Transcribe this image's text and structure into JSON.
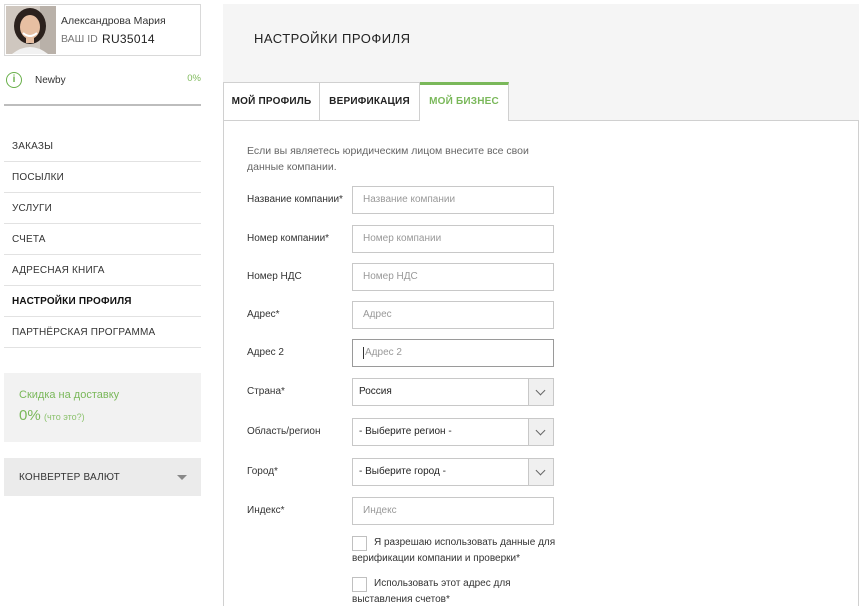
{
  "user": {
    "name": "Александрова Мария",
    "id_label": "ВАШ ID",
    "id_value": "RU35014"
  },
  "level": {
    "icon": "info-icon",
    "name": "Newby",
    "progress": "0%"
  },
  "menu": {
    "items": [
      {
        "label": "ЗАКАЗЫ",
        "active": false
      },
      {
        "label": "ПОСЫЛКИ",
        "active": false
      },
      {
        "label": "УСЛУГИ",
        "active": false
      },
      {
        "label": "СЧЕТА",
        "active": false
      },
      {
        "label": "АДРЕСНАЯ КНИГА",
        "active": false
      },
      {
        "label": "НАСТРОЙКИ ПРОФИЛЯ",
        "active": true
      },
      {
        "label": "ПАРТНЁРСКАЯ ПРОГРАММА",
        "active": false
      }
    ]
  },
  "discount": {
    "title": "Скидка на доставку",
    "value": "0%",
    "what_link": "(что это?)"
  },
  "converter": {
    "label": "КОНВЕРТЕР ВАЛЮТ"
  },
  "page": {
    "title": "НАСТРОЙКИ ПРОФИЛЯ"
  },
  "tabs": [
    {
      "label": "МОЙ ПРОФИЛЬ",
      "active": false
    },
    {
      "label": "ВЕРИФИКАЦИЯ",
      "active": false
    },
    {
      "label": "МОЙ БИЗНЕС",
      "active": true
    }
  ],
  "form": {
    "intro": "Если вы являетесь юридическим лицом внесите все свои данные компании.",
    "company_name": {
      "label": "Название компании*",
      "placeholder": "Название компании",
      "value": ""
    },
    "company_number": {
      "label": "Номер компании*",
      "placeholder": "Номер компании",
      "value": ""
    },
    "vat": {
      "label": "Номер НДС",
      "placeholder": "Номер НДС",
      "value": ""
    },
    "address": {
      "label": "Адрес*",
      "placeholder": "Адрес",
      "value": ""
    },
    "address2": {
      "label": "Адрес 2",
      "placeholder": "Адрес 2",
      "value": ""
    },
    "country": {
      "label": "Страна*",
      "selected": "Россия"
    },
    "region": {
      "label": "Область/регион",
      "selected": "- Выберите регион -"
    },
    "city": {
      "label": "Город*",
      "selected": "- Выберите город -"
    },
    "zip": {
      "label": "Индекс*",
      "placeholder": "Индекс",
      "value": ""
    },
    "consent": {
      "text": "Я разрешаю использовать данные для верификации компании и проверки*",
      "checked": false
    },
    "billing": {
      "text": "Использовать этот адрес для выставления счетов*",
      "checked": false
    }
  },
  "colors": {
    "accent": "#7ab85a",
    "panel_bg": "#f5f5f5",
    "border": "#d0d0d0"
  }
}
